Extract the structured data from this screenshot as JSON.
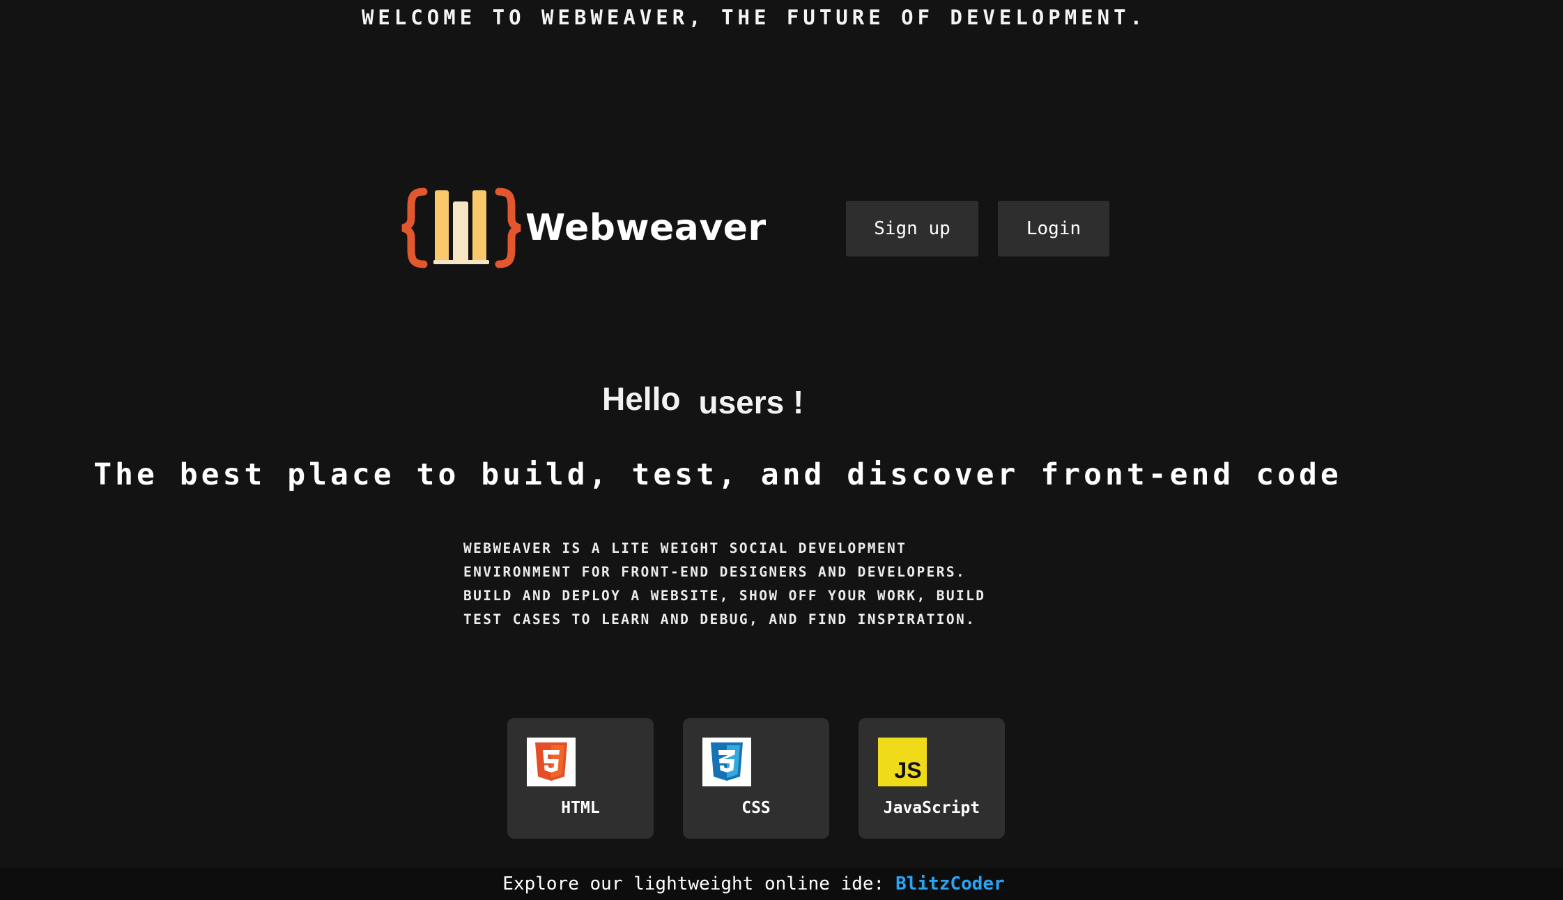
{
  "banner": {
    "text": "WELCOME TO WEBWEAVER, THE FUTURE OF DEVELOPMENT."
  },
  "brand": {
    "name": "Webweaver",
    "logo_icon": "braces-books-logo",
    "colors": {
      "brace": "#e2572e",
      "book_light": "#f7e6c4",
      "book_gold": "#f9c86a"
    }
  },
  "auth": {
    "signup_label": "Sign up",
    "login_label": "Login"
  },
  "hero": {
    "greeting": "Hello",
    "greeting_target": "users !",
    "tagline": "The best place to build, test, and discover front-end code",
    "description_lines": [
      "WEBWEAVER IS A LITE WEIGHT SOCIAL DEVELOPMENT",
      "ENVIRONMENT FOR FRONT-END DESIGNERS AND DEVELOPERS.",
      "BUILD AND DEPLOY A WEBSITE, SHOW OFF YOUR WORK, BUILD",
      "TEST CASES TO LEARN AND DEBUG, AND FIND INSPIRATION."
    ]
  },
  "technologies": [
    {
      "label": "HTML",
      "icon": "html5-icon",
      "color": "#e44d26"
    },
    {
      "label": "CSS",
      "icon": "css3-icon",
      "color": "#1572b6"
    },
    {
      "label": "JavaScript",
      "icon": "javascript-icon",
      "color": "#f0db1b",
      "icon_text": "JS"
    }
  ],
  "footer": {
    "text": "Explore our lightweight online ide:",
    "link_label": "BlitzCoder",
    "link_color": "#2aa4f4"
  }
}
